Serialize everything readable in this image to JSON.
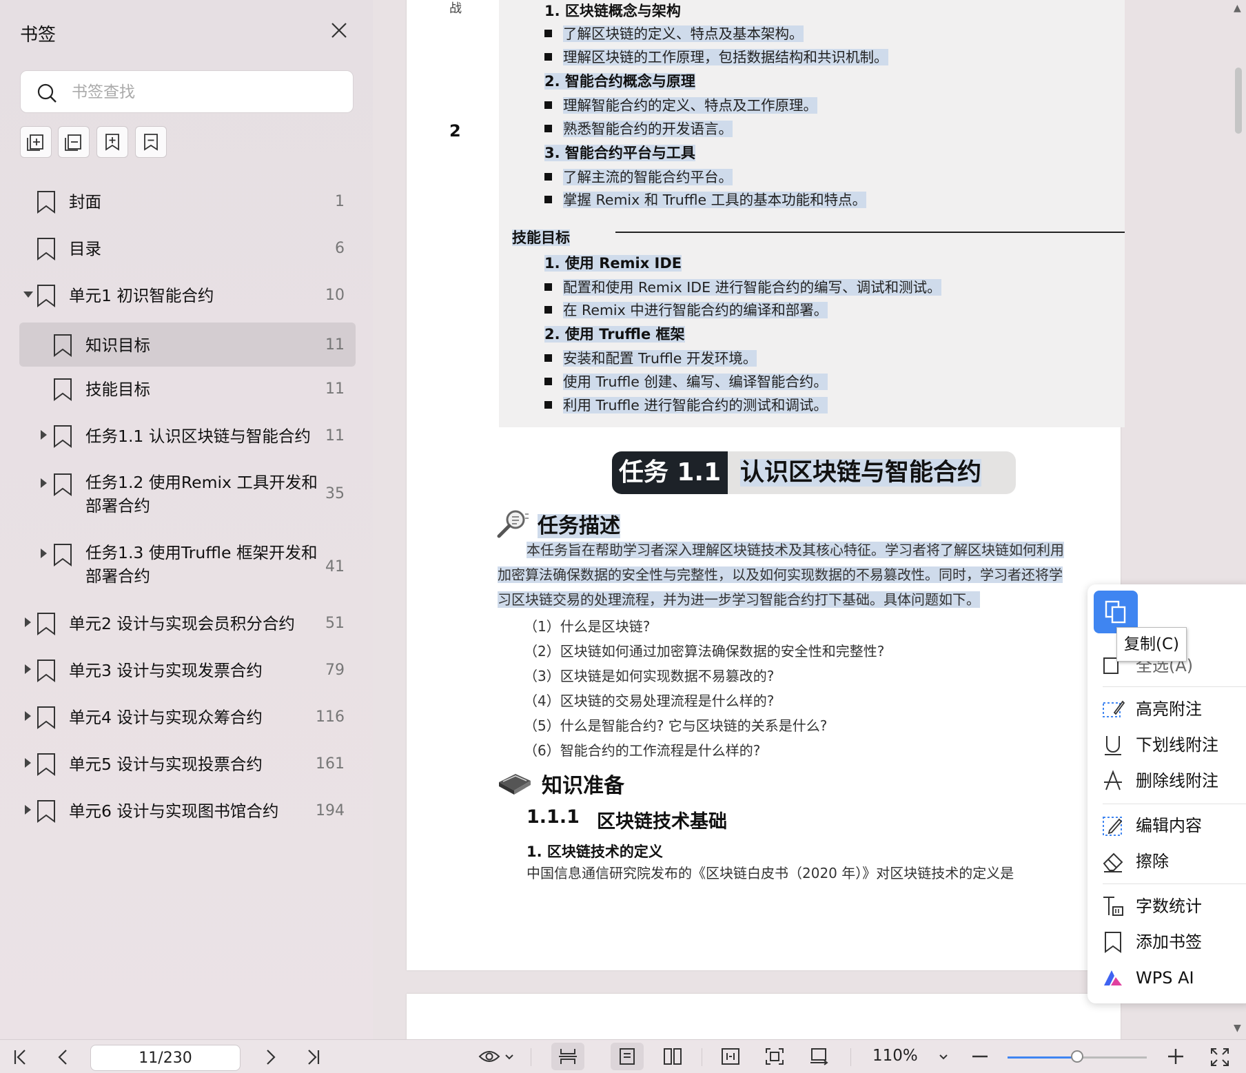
{
  "sidebar": {
    "title": "书签",
    "search_placeholder": "书签查找",
    "bookmarks": [
      {
        "label": "封面",
        "page": "1"
      },
      {
        "label": "目录",
        "page": "6"
      },
      {
        "label": "单元1 初识智能合约",
        "page": "10"
      },
      {
        "label": "知识目标",
        "page": "11"
      },
      {
        "label": "技能目标",
        "page": "11"
      },
      {
        "label": "任务1.1 认识区块链与智能合约",
        "page": "11"
      },
      {
        "label": "任务1.2 使用Remix 工具开发和部署合约",
        "page": "35"
      },
      {
        "label": "任务1.3 使用Truffle 框架开发和部署合约",
        "page": "41"
      },
      {
        "label": "单元2 设计与实现会员积分合约",
        "page": "51"
      },
      {
        "label": "单元3 设计与实现发票合约",
        "page": "79"
      },
      {
        "label": "单元4 设计与实现众筹合约",
        "page": "116"
      },
      {
        "label": "单元5 设计与实现投票合约",
        "page": "161"
      },
      {
        "label": "单元6 设计与实现图书馆合约",
        "page": "194"
      }
    ]
  },
  "document": {
    "margin_marks": [
      "战",
      "2"
    ],
    "goals": [
      "1. 区块链概念与架构",
      "了解区块链的定义、特点及基本架构。",
      "理解区块链的工作原理，包括数据结构和共识机制。",
      "2. 智能合约概念与原理",
      "理解智能合约的定义、特点及工作原理。",
      "熟悉智能合约的开发语言。",
      "3. 智能合约平台与工具",
      "了解主流的智能合约平台。",
      "掌握 Remix 和 Truffle 工具的基本功能和特点。"
    ],
    "skill_title": "技能目标",
    "skills": [
      "1. 使用 Remix IDE",
      "配置和使用 Remix IDE 进行智能合约的编写、调试和测试。",
      "在 Remix 中进行智能合约的编译和部署。",
      "2. 使用 Truffle 框架",
      "安装和配置 Truffle 开发环境。",
      "使用 Truffle 创建、编写、编译智能合约。",
      "利用 Truffle 进行智能合约的测试和调试。"
    ],
    "task_num": "任务 1.1",
    "task_name": "认识区块链与智能合约",
    "task_desc_title": "任务描述",
    "task_desc_lines": [
      "本任务旨在帮助学习者深入理解区块链技术及其核心特征。学习者将了解区块链如何利用",
      "加密算法确保数据的安全性与完整性，以及如何实现数据的不易篡改性。同时，学习者还将学",
      "习区块链交易的处理流程，并为进一步学习智能合约打下基础。具体问题如下。"
    ],
    "questions": [
      "（1）什么是区块链?",
      "（2）区块链如何通过加密算法确保数据的安全性和完整性?",
      "（3）区块链是如何实现数据不易篡改的?",
      "（4）区块链的交易处理流程是什么样的?",
      "（5）什么是智能合约? 它与区块链的关系是什么?",
      "（6）智能合约的工作流程是什么样的?"
    ],
    "knowledge_title": "知识准备",
    "section_num": "1.1.1",
    "section_title": "区块链技术基础",
    "subsection": "1. 区块链技术的定义",
    "body_line": "中国信息通信研究院发布的《区块链白皮书（2020 年）》对区块链技术的定义是"
  },
  "context_menu": {
    "copy_tooltip": "复制(C)",
    "hidden_item": "全选(A)",
    "items": [
      {
        "label": "高亮附注",
        "icon": "highlight-icon"
      },
      {
        "label": "下划线附注",
        "icon": "underline-icon"
      },
      {
        "label": "删除线附注",
        "icon": "strikethrough-icon"
      },
      {
        "label": "编辑内容",
        "icon": "edit-icon"
      },
      {
        "label": "擦除",
        "icon": "eraser-icon"
      },
      {
        "label": "字数统计",
        "icon": "word-count-icon"
      },
      {
        "label": "添加书签",
        "icon": "bookmark-icon"
      },
      {
        "label": "WPS AI",
        "icon": "wps-ai-icon"
      }
    ]
  },
  "bottombar": {
    "page_indicator": "11/230",
    "zoom": "110%",
    "zoom_fraction": 0.5
  },
  "colors": {
    "accent": "#3f85f1",
    "selection_highlight": "#cfdbeb",
    "task_banner_dark": "#1d2228"
  }
}
